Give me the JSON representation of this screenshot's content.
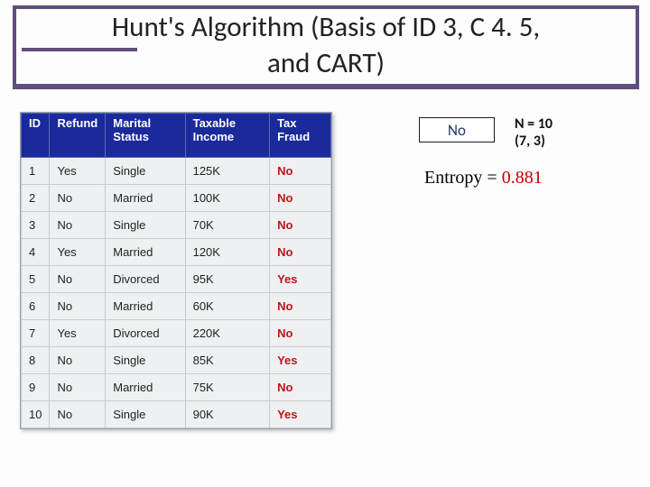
{
  "title": {
    "line1": "Hunt's Algorithm (Basis of ID 3, C 4. 5,",
    "line2": "and CART)"
  },
  "table": {
    "headers": {
      "id": "ID",
      "refund": "Refund",
      "marital": "Marital Status",
      "income": "Taxable Income",
      "fraud": "Tax Fraud"
    },
    "rows": [
      {
        "id": "1",
        "refund": "Yes",
        "marital": "Single",
        "income": "125K",
        "fraud": "No"
      },
      {
        "id": "2",
        "refund": "No",
        "marital": "Married",
        "income": "100K",
        "fraud": "No"
      },
      {
        "id": "3",
        "refund": "No",
        "marital": "Single",
        "income": "70K",
        "fraud": "No"
      },
      {
        "id": "4",
        "refund": "Yes",
        "marital": "Married",
        "income": "120K",
        "fraud": "No"
      },
      {
        "id": "5",
        "refund": "No",
        "marital": "Divorced",
        "income": "95K",
        "fraud": "Yes"
      },
      {
        "id": "6",
        "refund": "No",
        "marital": "Married",
        "income": "60K",
        "fraud": "No"
      },
      {
        "id": "7",
        "refund": "Yes",
        "marital": "Divorced",
        "income": "220K",
        "fraud": "No"
      },
      {
        "id": "8",
        "refund": "No",
        "marital": "Single",
        "income": "85K",
        "fraud": "Yes"
      },
      {
        "id": "9",
        "refund": "No",
        "marital": "Married",
        "income": "75K",
        "fraud": "No"
      },
      {
        "id": "10",
        "refund": "No",
        "marital": "Single",
        "income": "90K",
        "fraud": "Yes"
      }
    ]
  },
  "node": {
    "label": "No",
    "n_label": "N = 10",
    "dist_label": "(7, 3)"
  },
  "entropy": {
    "label": "Entropy = ",
    "value": "0.881"
  },
  "chart_data": {
    "type": "table",
    "title": "Hunt's Algorithm (Basis of ID3, C4.5, and CART)",
    "columns": [
      "ID",
      "Refund",
      "Marital Status",
      "Taxable Income",
      "Tax Fraud"
    ],
    "rows": [
      [
        1,
        "Yes",
        "Single",
        "125K",
        "No"
      ],
      [
        2,
        "No",
        "Married",
        "100K",
        "No"
      ],
      [
        3,
        "No",
        "Single",
        "70K",
        "No"
      ],
      [
        4,
        "Yes",
        "Married",
        "120K",
        "No"
      ],
      [
        5,
        "No",
        "Divorced",
        "95K",
        "Yes"
      ],
      [
        6,
        "No",
        "Married",
        "60K",
        "No"
      ],
      [
        7,
        "Yes",
        "Divorced",
        "220K",
        "No"
      ],
      [
        8,
        "No",
        "Single",
        "85K",
        "Yes"
      ],
      [
        9,
        "No",
        "Married",
        "75K",
        "No"
      ],
      [
        10,
        "No",
        "Single",
        "90K",
        "Yes"
      ]
    ],
    "root_node": {
      "predicted_class": "No",
      "N": 10,
      "class_counts": [
        7,
        3
      ],
      "entropy": 0.881
    }
  }
}
